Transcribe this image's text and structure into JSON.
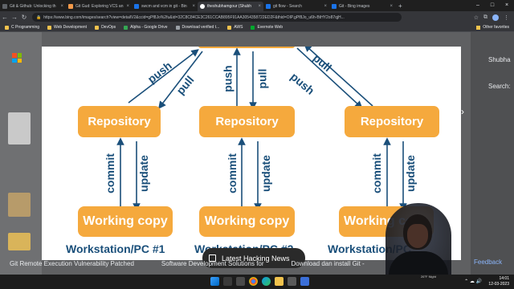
{
  "tabs": [
    {
      "title": "Git & Github: Unlocking th",
      "color": "#5f6368",
      "active": false
    },
    {
      "title": "Git Gud: Exploring VCS an",
      "color": "#f2994a",
      "active": false
    },
    {
      "title": "swcm and vcm in git - Bin",
      "color": "#1a73e8",
      "active": false
    },
    {
      "title": "theshubhamgour (Shubh",
      "color": "#ffffff",
      "active": true
    },
    {
      "title": "git flow - Search",
      "color": "#1a73e8",
      "active": false
    },
    {
      "title": "Git - Bing images",
      "color": "#1a73e8",
      "active": false
    }
  ],
  "address": {
    "url": "https://www.bing.com/images/search?view=detailV2&ccid=gPf8Jo%2fu&id=32C8C84CE3C261CCAB895F91AA3054358722ED2F&thid=OIP.gPf8Jo_u6h-BtHY2o87qjH..."
  },
  "bookmarks": [
    "C Programming",
    "Web Development",
    "DevOps",
    "Alpha - Google Drive",
    "Download verified t...",
    "AWS",
    "Evernote Web"
  ],
  "bookmarks_other": "Other favorites",
  "diagram": {
    "repositories": [
      "Repository",
      "Repository",
      "Repository"
    ],
    "working_copies": [
      "Working copy",
      "Working copy",
      "Working co"
    ],
    "stations": [
      "Workstation/PC #1",
      "Workstation/PC #2",
      "Workstation/PC"
    ],
    "top_arrows": {
      "push_left": "push",
      "pull_left": "pull",
      "push_mid": "push",
      "pull_mid": "pull",
      "pull_right": "pull",
      "push_right": "push"
    },
    "commit_label": "commit",
    "update_label": "update"
  },
  "toast": {
    "label": "Latest Hacking News"
  },
  "related_results": [
    "Git Remote Execution Vulnerability Patched",
    "Software Development Solutions for",
    "Download dan install Git -"
  ],
  "side": {
    "profile_text": "Shubha",
    "search_label": "Search:",
    "feedback": "Feedback"
  },
  "taskbar": {
    "time": "14:01",
    "date": "12-03-2023",
    "weather": "26°F Night"
  }
}
